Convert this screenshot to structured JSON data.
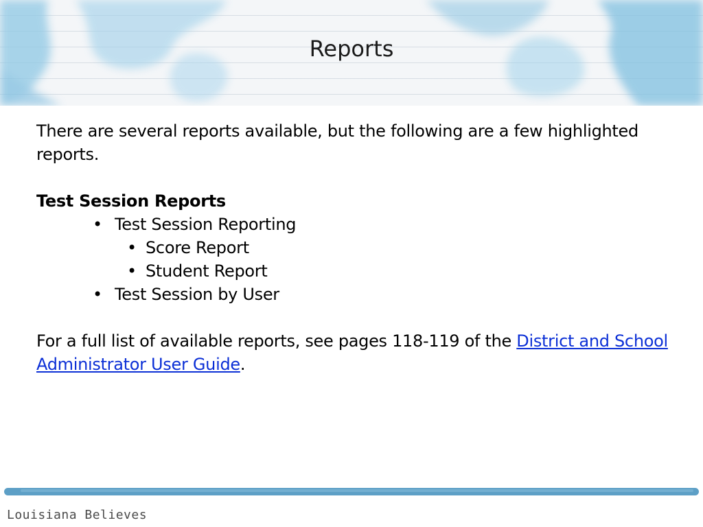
{
  "slide": {
    "title": "Reports",
    "intro": "There are several reports available, but the following are a few highlighted reports.",
    "section_heading": "Test Session Reports",
    "bullets": [
      {
        "label": "Test Session Reporting"
      },
      {
        "label": "Score Report"
      },
      {
        "label": "Student Report"
      },
      {
        "label": "Test Session by User"
      }
    ],
    "footnote_prefix": "For a full list of available reports, see pages 118-119 of the ",
    "footnote_link": "District and School Administrator User Guide",
    "footnote_suffix": "."
  },
  "footer": {
    "brand": "Louisiana Believes"
  },
  "colors": {
    "watercolor": "#8ec7e4",
    "link": "#0b2fd6",
    "footer_bar": "#5d9fc6"
  }
}
